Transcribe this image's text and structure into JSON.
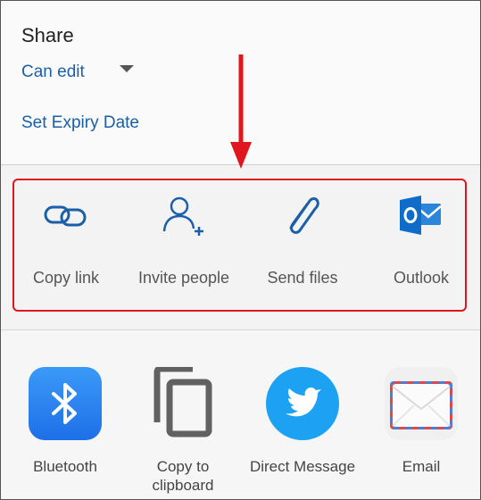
{
  "share": {
    "title": "Share",
    "permission": "Can edit",
    "expiry": "Set Expiry Date"
  },
  "actions": [
    {
      "label": "Copy link",
      "icon": "link-icon"
    },
    {
      "label": "Invite people",
      "icon": "add-person-icon"
    },
    {
      "label": "Send files",
      "icon": "paperclip-icon"
    },
    {
      "label": "Outlook",
      "icon": "outlook-icon"
    }
  ],
  "apps": [
    {
      "label": "Bluetooth",
      "icon": "bluetooth-icon"
    },
    {
      "label": "Copy to clipboard",
      "icon": "clipboard-icon"
    },
    {
      "label": "Direct Message",
      "icon": "twitter-icon"
    },
    {
      "label": "Email",
      "icon": "envelope-icon"
    }
  ],
  "colors": {
    "accent": "#1a5fa8",
    "highlight": "#e0161e",
    "bluetooth": "#2a7cf0",
    "twitter": "#1da1f2",
    "outlook": "#0f6cc8"
  }
}
